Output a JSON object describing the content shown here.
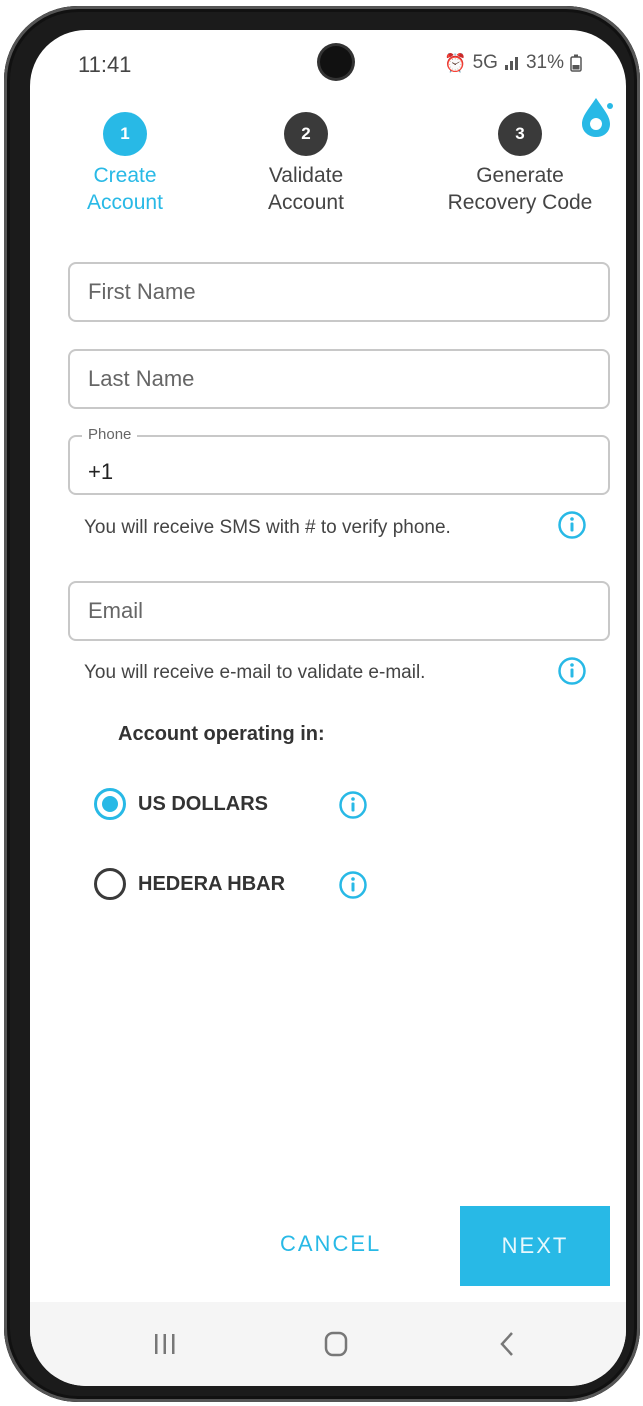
{
  "status": {
    "time": "11:41",
    "network": "5G",
    "battery": "31%"
  },
  "colors": {
    "accent": "#28b9e6",
    "inactive": "#3a3a3a"
  },
  "steps": [
    {
      "number": "1",
      "line1": "Create",
      "line2": "Account",
      "state": "active"
    },
    {
      "number": "2",
      "line1": "Validate",
      "line2": "Account",
      "state": "inactive"
    },
    {
      "number": "3",
      "line1": "Generate",
      "line2": "Recovery Code",
      "state": "inactive"
    }
  ],
  "form": {
    "first_name_placeholder": "First Name",
    "last_name_placeholder": "Last Name",
    "phone_label": "Phone",
    "phone_value": "+1",
    "phone_hint": "You will receive SMS with # to verify phone.",
    "email_placeholder": "Email",
    "email_hint": "You will receive e-mail to validate e-mail."
  },
  "currency": {
    "title": "Account operating in:",
    "options": [
      {
        "label": "US DOLLARS",
        "selected": true
      },
      {
        "label": "HEDERA HBAR",
        "selected": false
      }
    ]
  },
  "actions": {
    "cancel": "CANCEL",
    "next": "NEXT"
  },
  "icons": {
    "info": "info-circle-icon",
    "logo": "drop-logo-icon",
    "nav": [
      "recent-apps-icon",
      "home-icon",
      "back-icon"
    ]
  }
}
